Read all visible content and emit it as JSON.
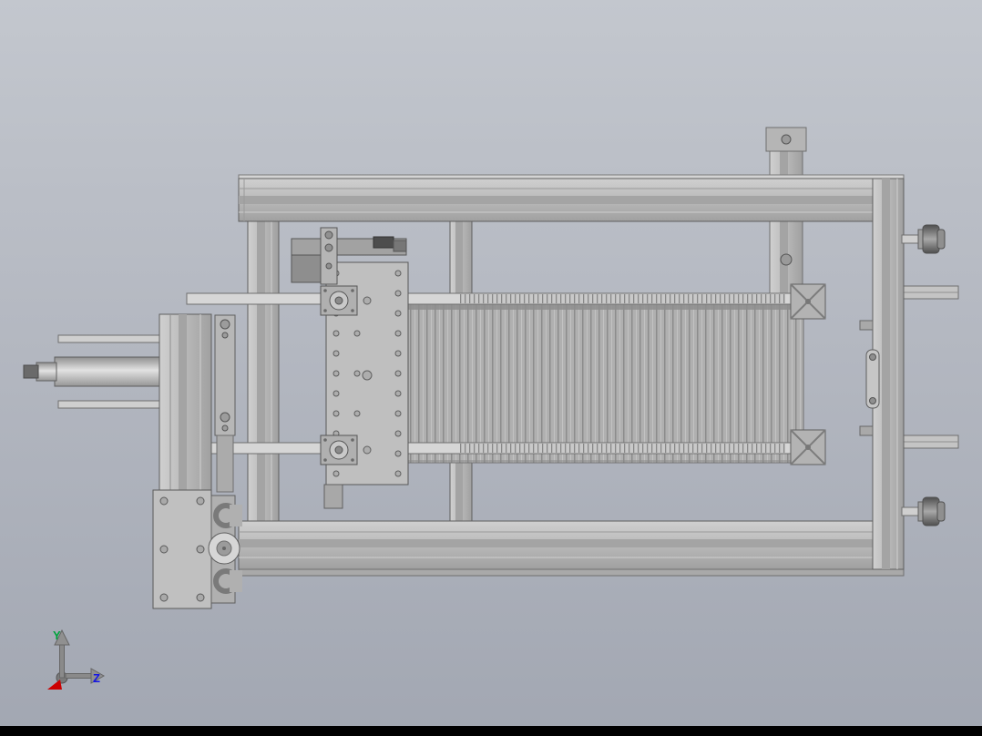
{
  "scene": {
    "description": "CAD viewport showing a front view of an aluminum-extrusion machine frame assembly with ribbed conveyor panel, guide rods, lead screws, carriage plate and hand knobs",
    "background_top": "#c3c7ce",
    "background_bottom": "#a2a7b2",
    "bottom_bar_color": "#000000"
  },
  "triad": {
    "y_label": "Y",
    "z_label": "Z",
    "y_color": "#00a33c",
    "z_color": "#1414e6",
    "x_color": "#cc0000",
    "arrow_color": "#8a8a8a"
  },
  "machine": {
    "body_color": "#b8b8b8",
    "highlight_color": "#d6d6d6",
    "edge_color": "#5f5f5f",
    "panel_color": "#b0b0b0",
    "dark_detail_color": "#4d4d4d",
    "parts": [
      "frame-top-beam",
      "frame-bottom-beam",
      "frame-right-upright",
      "frame-left-upright",
      "frame-middle-upright",
      "vertical-post",
      "ribbed-panel",
      "upper-guide-rod",
      "lower-guide-rod",
      "lead-screw-threads",
      "carriage-plate",
      "top-actuator",
      "left-mount-plate",
      "shaft-assembly",
      "bottom-left-plate",
      "roller-bracket",
      "adjustment-knob-upper",
      "adjustment-knob-lower",
      "cross-connector-upper",
      "cross-connector-lower",
      "right-slot-plate",
      "right-side-rails"
    ]
  }
}
